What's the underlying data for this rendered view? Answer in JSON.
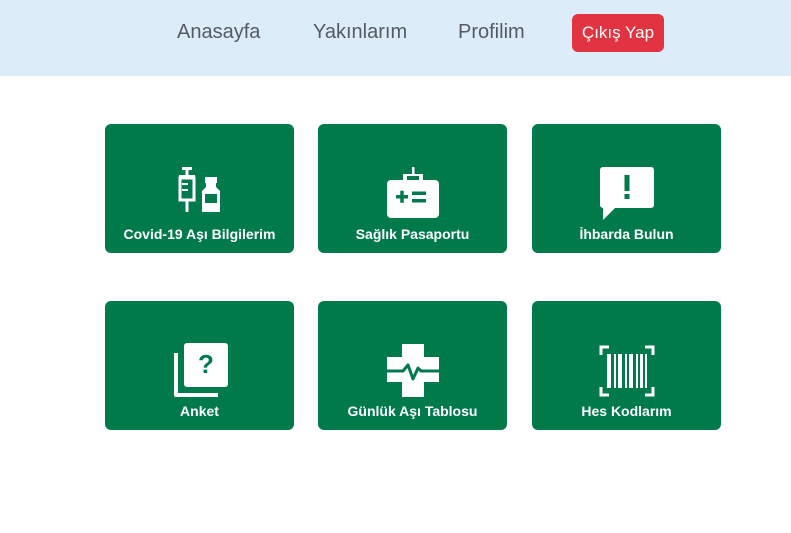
{
  "nav": {
    "home": "Anasayfa",
    "relatives": "Yakınlarım",
    "profile": "Profilim",
    "logout": "Çıkış Yap"
  },
  "colors": {
    "navbar_bg": "#ddecf9",
    "tile_bg": "#007a4b",
    "logout_bg": "#e23340"
  },
  "tiles": [
    {
      "label": "Covid-19 Aşı Bilgilerim",
      "icon": "syringe-vial-icon"
    },
    {
      "label": "Sağlık Pasaportu",
      "icon": "medical-briefcase-icon"
    },
    {
      "label": "İhbarda Bulun",
      "icon": "exclamation-comment-icon"
    },
    {
      "label": "Anket",
      "icon": "question-cards-icon"
    },
    {
      "label": "Günlük Aşı Tablosu",
      "icon": "heartbeat-cross-icon"
    },
    {
      "label": "Hes Kodlarım",
      "icon": "barcode-scan-icon"
    }
  ]
}
